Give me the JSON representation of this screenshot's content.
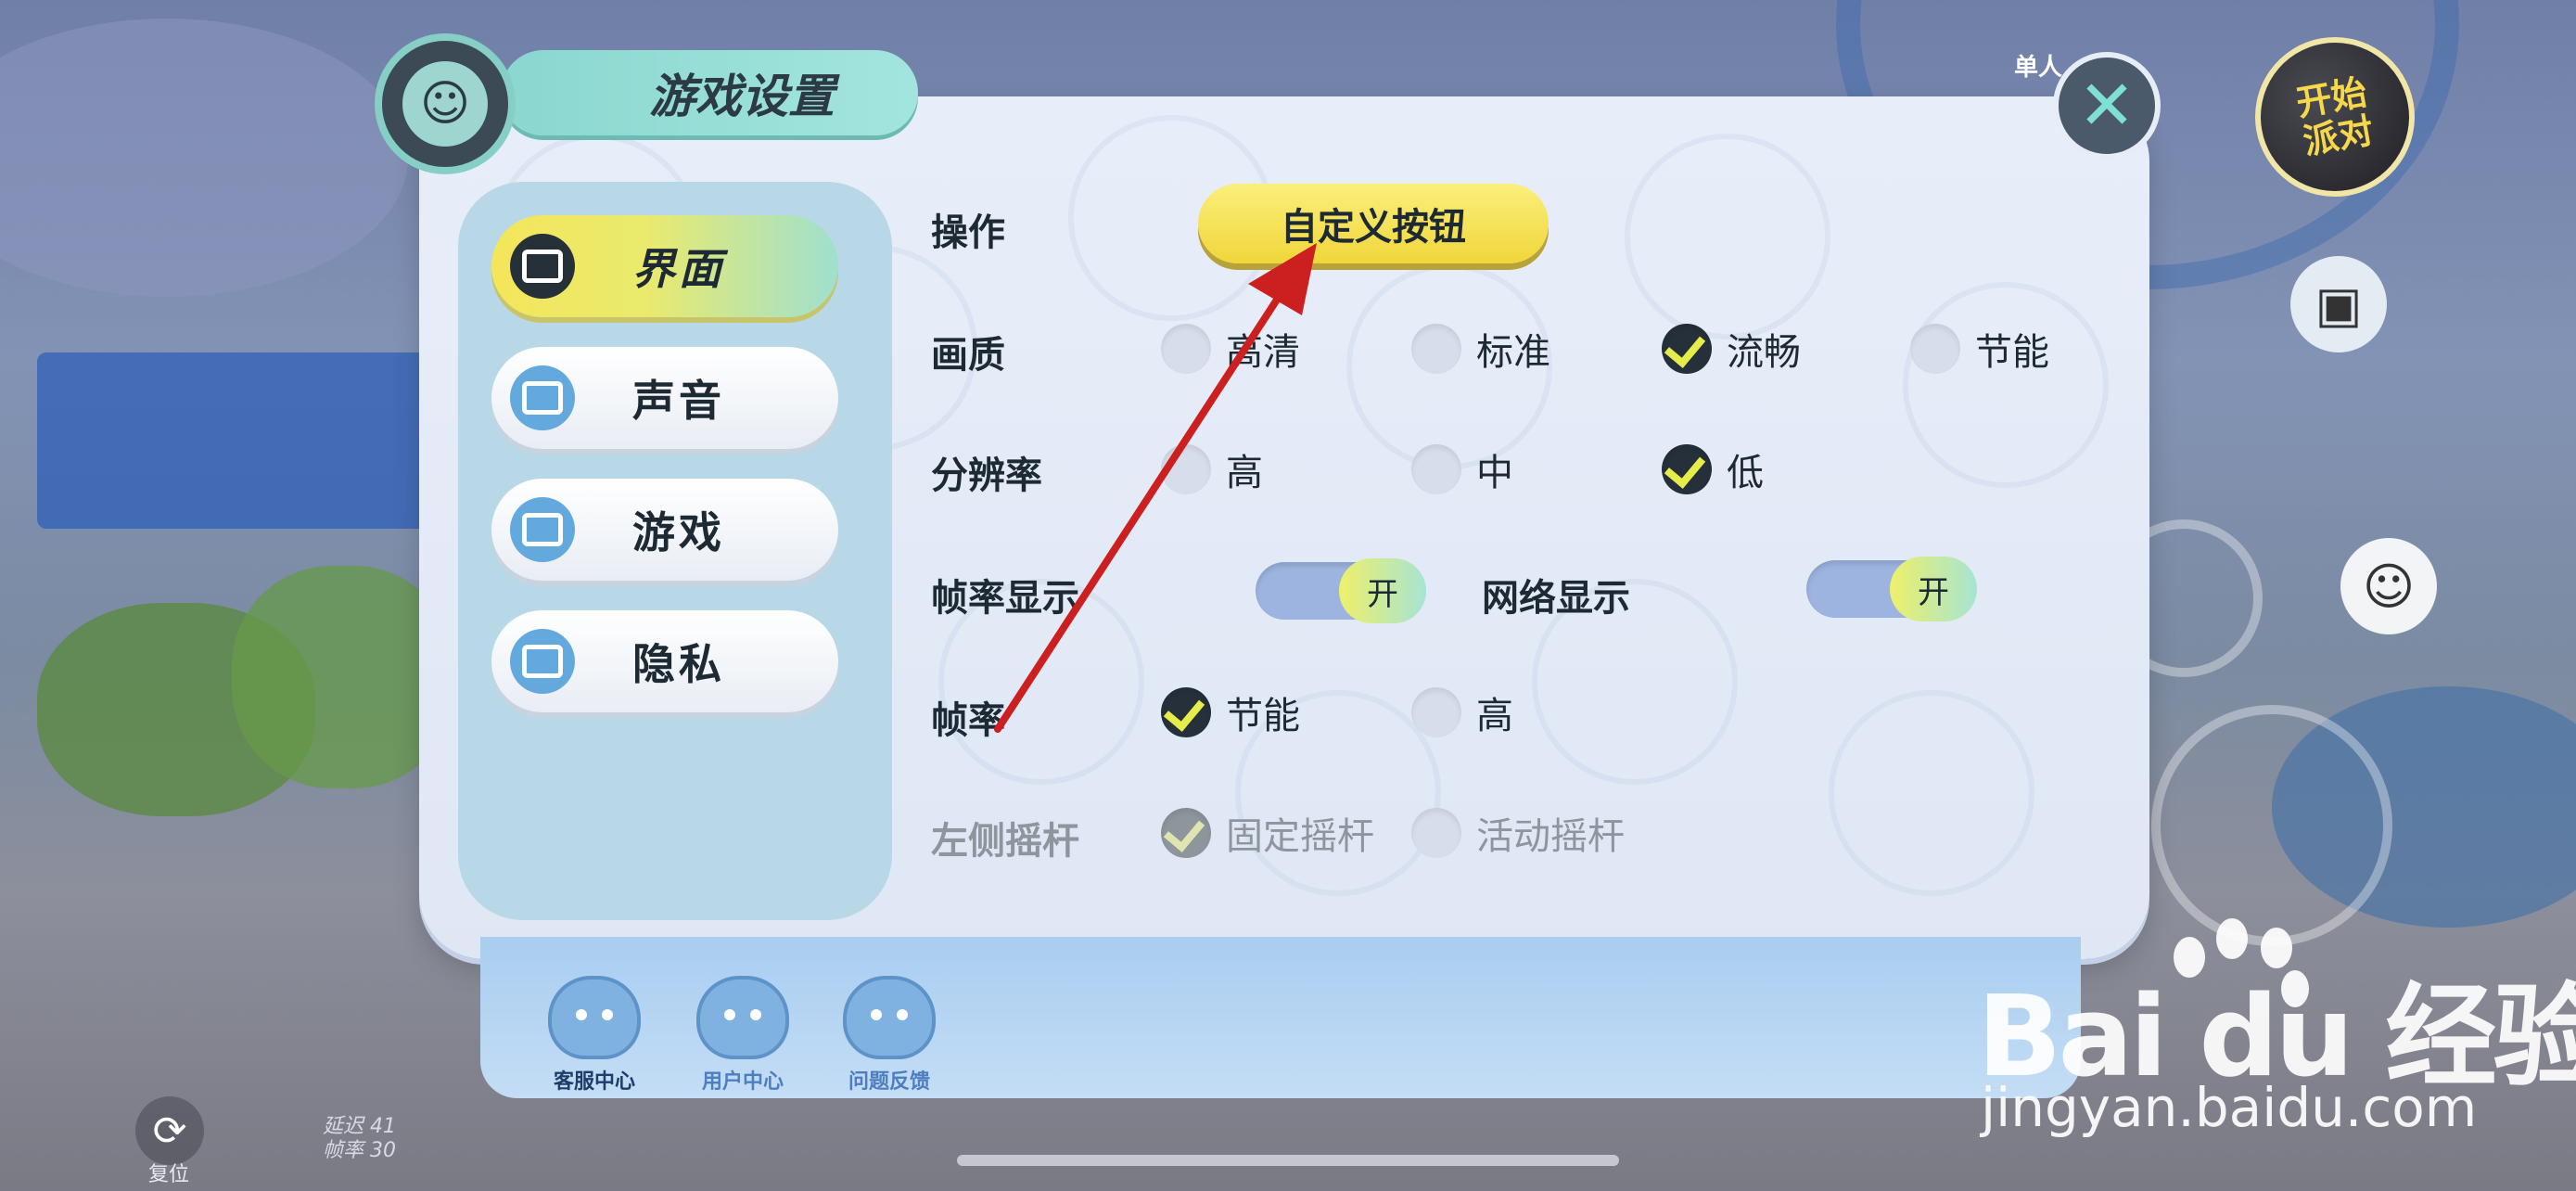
{
  "title": "游戏设置",
  "nav": [
    {
      "label": "界面",
      "active": true
    },
    {
      "label": "声音",
      "active": false
    },
    {
      "label": "游戏",
      "active": false
    },
    {
      "label": "隐私",
      "active": false
    }
  ],
  "settings": {
    "operation": {
      "label": "操作",
      "button": "自定义按钮"
    },
    "quality": {
      "label": "画质",
      "options": [
        "高清",
        "标准",
        "流畅",
        "节能"
      ],
      "selected": "流畅"
    },
    "resolution": {
      "label": "分辨率",
      "options": [
        "高",
        "中",
        "低"
      ],
      "selected": "低"
    },
    "fps_display": {
      "label": "帧率显示",
      "toggle": "开"
    },
    "network_display": {
      "label": "网络显示",
      "toggle": "开"
    },
    "frame_rate": {
      "label": "帧率",
      "options": [
        "节能",
        "高"
      ],
      "selected": "节能"
    },
    "left_stick": {
      "label": "左侧摇杆",
      "options": [
        "固定摇杆",
        "活动摇杆"
      ],
      "selected": "固定摇杆",
      "disabled": true
    }
  },
  "help": [
    {
      "label": "客服中心"
    },
    {
      "label": "用户中心"
    },
    {
      "label": "问题反馈"
    }
  ],
  "hud": {
    "mode": "单人",
    "start_party": "开始派对",
    "reset": "复位",
    "latency_label": "延迟",
    "latency_value": "41",
    "fps_label": "帧率",
    "fps_value": "30"
  },
  "watermark": {
    "brand": "Bai du 经验",
    "url": "jingyan.baidu.com"
  },
  "colors": {
    "accent_yellow": "#f0d63a",
    "annotation_arrow": "#cc1f1f",
    "panel_bg": "#e8eef9"
  }
}
